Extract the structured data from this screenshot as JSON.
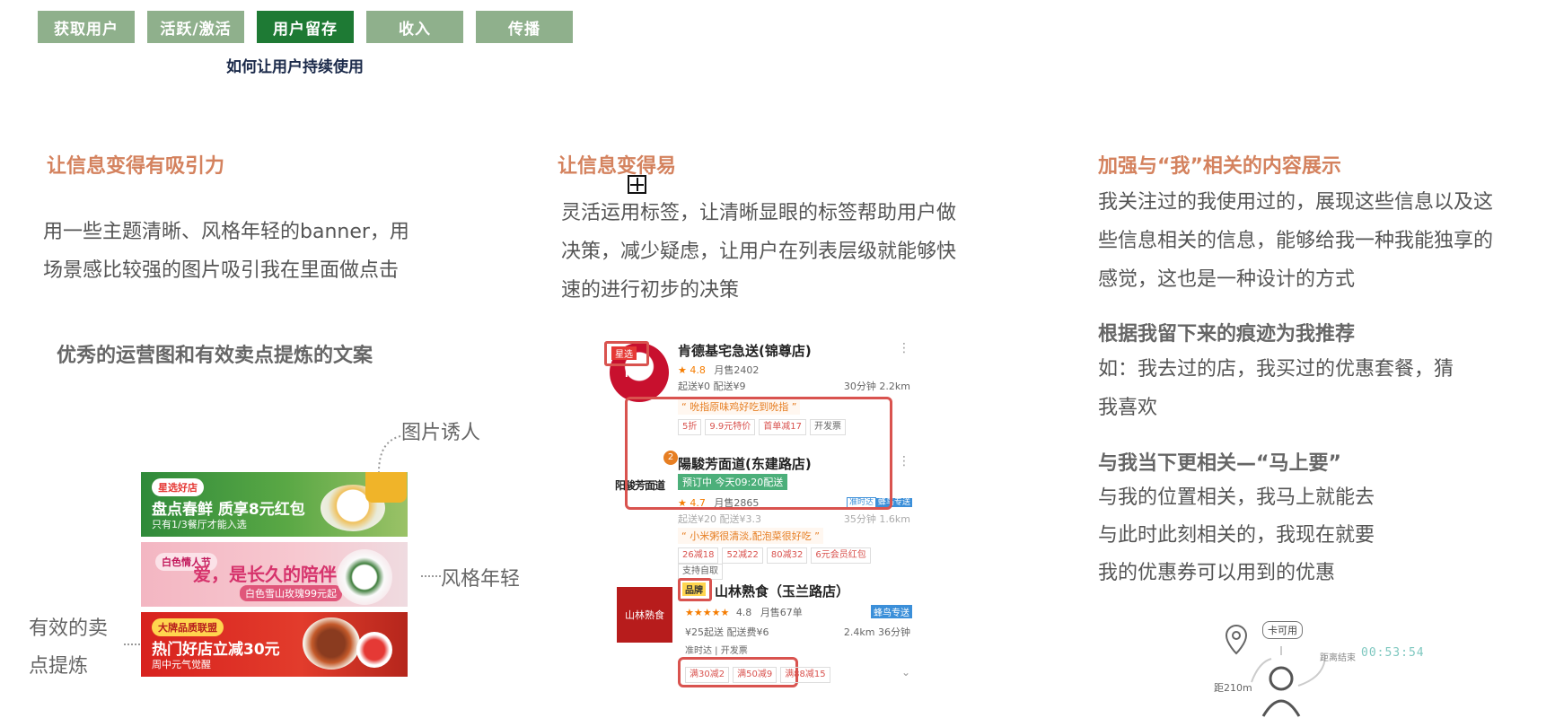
{
  "tabs": {
    "items": [
      "获取用户",
      "活跃/激活",
      "用户留存",
      "收入",
      "传播"
    ],
    "active_index": 2,
    "subtitle": "如何让用户持续使用"
  },
  "col1": {
    "heading": "让信息变得有吸引力",
    "para_line1": "用一些主题清晰、风格年轻的banner，用",
    "para_line2": "场景感比较强的图片吸引我在里面做点击",
    "subheading": "优秀的运营图和有效卖点提炼的文案",
    "label_image": "图片诱人",
    "label_style": "风格年轻",
    "label_selling_1": "有效的卖",
    "label_selling_2": "点提炼",
    "banners": [
      {
        "badge": "星选好店",
        "title": "盘点春鲜 质享8元红包",
        "sub": "只有1/3餐厅才能入选"
      },
      {
        "badge": "白色情人节",
        "title": "爱，是长久的陪伴",
        "sub": "白色雪山玫瑰99元起"
      },
      {
        "badge": "大牌品质联盟",
        "title": "热门好店立减30元",
        "sub": "周中元气觉醒"
      }
    ]
  },
  "col2": {
    "heading": "让信息变得易",
    "para_line1": "灵活运用标签，让清晰显眼的标签帮助用户做",
    "para_line2": "决策，减少疑虑，让用户在列表层级就能够快",
    "para_line3": "速的进行初步的决策",
    "stores": [
      {
        "badge": "星选",
        "name": "肯德基宅急送(锦尊店)",
        "rating": "4.8",
        "monthly": "月售2402",
        "min_order": "起送¥0  配送¥9",
        "time_dist": "30分钟  2.2km",
        "quote": "“ 吮指原味鸡好吃到吮指 ”",
        "tags": [
          "5折",
          "9.9元特价",
          "首单减17",
          "开发票"
        ],
        "logo_text": "KFC"
      },
      {
        "badge": "2",
        "name": "陽駿芳面道(东建路店)",
        "status": "预订中  今天09:20配送",
        "rating": "4.7",
        "monthly": "月售2865",
        "min_order": "起送¥20  配送¥3.3",
        "time_dist": "35分钟  1.6km",
        "quote": "“ 小米粥很清淡,配泡菜很好吃 ”",
        "tags": [
          "26减18",
          "52减22",
          "80减32",
          "6元会员红包",
          "支持自取"
        ],
        "deliv_tags": [
          "准时达",
          "蜂鸟专送"
        ],
        "logo_text": "阳骏芳面道"
      },
      {
        "badge": "品牌",
        "name": "山林熟食（玉兰路店）",
        "rating": "4.8",
        "monthly": "月售67单",
        "min_order": "¥25起送    配送费¥6",
        "time_dist": "2.4km  36分钟",
        "extra": "准时达 | 开发票",
        "tags": [
          "满30减2",
          "满50减9",
          "满88减15"
        ],
        "deliv_tags": [
          "蜂鸟专送"
        ],
        "logo_text": "山林熟食"
      }
    ]
  },
  "col3": {
    "heading": "加强与“我”相关的内容展示",
    "para1_line1": "我关注过的我使用过的，展现这些信息以及这",
    "para1_line2": "些信息相关的信息，能够给我一种我能独享的",
    "para1_line3": "感觉，这也是一种设计的方式",
    "sub1": "根据我留下来的痕迹为我推荐",
    "para2_line1": "如：我去过的店，我买过的优惠套餐，猜",
    "para2_line2": "我喜欢",
    "sub2": "与我当下更相关—“马上要”",
    "para3_line1": "与我的位置相关，我马上就能去",
    "para3_line2": "与此时此刻相关的，我现在就要",
    "para3_line3": "我的优惠券可以用到的优惠",
    "illus": {
      "card_label": "卡可用",
      "distance": "距210m",
      "countdown_label": "距离结束",
      "countdown": "00:53:54"
    }
  },
  "colors": {
    "tab": "#8fb08c",
    "tab_active": "#1e7a34",
    "heading_orange": "#d4825e",
    "highlight_red": "#d9534f"
  }
}
